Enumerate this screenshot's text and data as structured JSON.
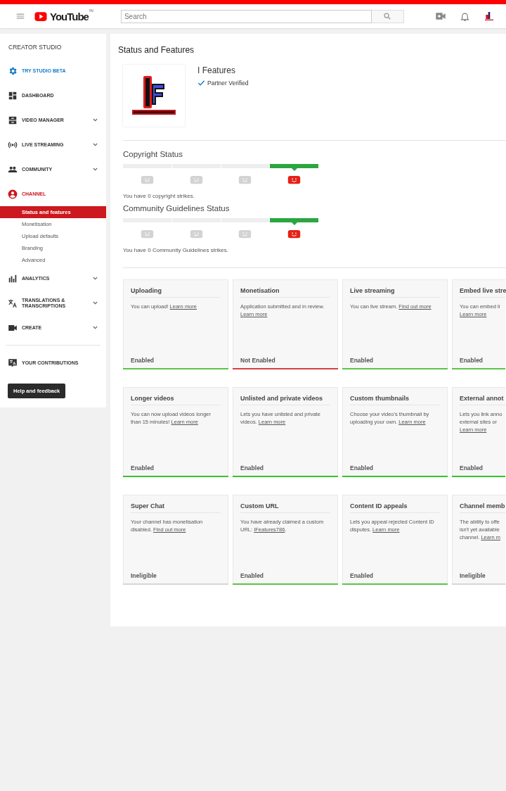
{
  "header": {
    "logo": "YouTube",
    "region": "IN",
    "search": {
      "placeholder": "Search"
    }
  },
  "sidebar": {
    "title": "CREATOR STUDIO",
    "items": [
      {
        "kind": "gear",
        "label": "TRY STUDIO BETA",
        "expandable": false,
        "selected": false,
        "accent": true
      },
      {
        "kind": "dashboard",
        "label": "DASHBOARD",
        "expandable": false,
        "selected": false,
        "accent": false
      },
      {
        "kind": "videos",
        "label": "VIDEO MANAGER",
        "expandable": true,
        "selected": false,
        "accent": false
      },
      {
        "kind": "live",
        "label": "LIVE STREAMING",
        "expandable": true,
        "selected": false,
        "accent": false
      },
      {
        "kind": "people",
        "label": "COMMUNITY",
        "expandable": true,
        "selected": false,
        "accent": false
      },
      {
        "kind": "account",
        "label": "CHANNEL",
        "expandable": false,
        "selected": true,
        "accent": false,
        "children": [
          {
            "label": "Status and features",
            "selected": true
          },
          {
            "label": "Monetisation",
            "selected": false
          },
          {
            "label": "Upload defaults",
            "selected": false
          },
          {
            "label": "Branding",
            "selected": false
          },
          {
            "label": "Advanced",
            "selected": false
          }
        ]
      },
      {
        "kind": "chart",
        "label": "ANALYTICS",
        "expandable": true,
        "selected": false,
        "accent": false
      },
      {
        "kind": "translate",
        "label": "TRANSLATIONS & TRANSCRIPTIONS",
        "expandable": true,
        "selected": false,
        "accent": false
      },
      {
        "kind": "camera",
        "label": "CREATE",
        "expandable": true,
        "selected": false,
        "accent": false
      },
      {
        "kind": "divider"
      },
      {
        "kind": "contrib",
        "label": "YOUR CONTRIBUTIONS",
        "expandable": false,
        "selected": false,
        "accent": false
      }
    ],
    "button": "Help and feedback"
  },
  "page": {
    "title": "Status and Features",
    "channel": {
      "name": "I Features",
      "badge": "Partner Verified"
    },
    "statuses": [
      {
        "title": "Copyright Status",
        "segments": [
          {
            "kind": "sad",
            "selected": false
          },
          {
            "kind": "confused",
            "selected": false
          },
          {
            "kind": "neutral",
            "selected": false
          },
          {
            "kind": "happy",
            "selected": true
          }
        ],
        "message": "You have 0 copyright strikes."
      },
      {
        "title": "Community Guidelines Status",
        "segments": [
          {
            "kind": "sad",
            "selected": false
          },
          {
            "kind": "confused",
            "selected": false
          },
          {
            "kind": "neutral",
            "selected": false
          },
          {
            "kind": "happy",
            "selected": true
          }
        ],
        "message": "You have 0 Community Guidelines strikes."
      }
    ],
    "features": [
      {
        "title": "Uploading",
        "text": "You can upload!",
        "link": "Learn more",
        "status": "Enabled",
        "color": "#5ac445"
      },
      {
        "title": "Monetisation",
        "text": "Application submitted and in review.",
        "link": "Learn more",
        "status": "Not Enabled",
        "color": "#d0423f"
      },
      {
        "title": "Live streaming",
        "text": "You can live stream.",
        "link": "Find out more",
        "status": "Enabled",
        "color": "#5ac445"
      },
      {
        "title": "Embed live stre",
        "text": "You can embed li",
        "link": "Learn more",
        "status": "Enabled",
        "color": "#5ac445"
      },
      {
        "title": "Longer videos",
        "text": "You can now upload videos longer than 15 minutes!",
        "link": "Learn more",
        "status": "Enabled",
        "color": "#36c42a"
      },
      {
        "title": "Unlisted and private videos",
        "text": "Lets you have unlisted and private videos.",
        "link": "Learn more",
        "status": "Enabled",
        "color": "#36c42a"
      },
      {
        "title": "Custom thumbnails",
        "text": "Choose your video's thumbnail by uploading your own.",
        "link": "Learn more",
        "status": "Enabled",
        "color": "#36c42a"
      },
      {
        "title": "External annot",
        "text": "Lets you link anno external sites or",
        "link": "Learn more",
        "status": "Enabled",
        "color": "#36c42a"
      },
      {
        "title": "Super Chat",
        "text": "Your channel has monetisation disabled.",
        "link": "Find out more",
        "status": "Ineligible",
        "color": "#d6d6d6"
      },
      {
        "title": "Custom URL",
        "text": "You have already claimed a custom URL:",
        "link": "IFeatures786",
        "tail": ".",
        "status": "Enabled",
        "color": "#5ac445"
      },
      {
        "title": "Content ID appeals",
        "text": "Lets you appeal rejected Content ID disputes.",
        "link": "Learn more",
        "status": "Enabled",
        "color": "#5ac445"
      },
      {
        "title": "Channel memb",
        "text": "The ability to offe isn't yet available channel.",
        "link": "Learn m",
        "status": "Ineligible",
        "color": "#d6d6d6"
      }
    ]
  }
}
